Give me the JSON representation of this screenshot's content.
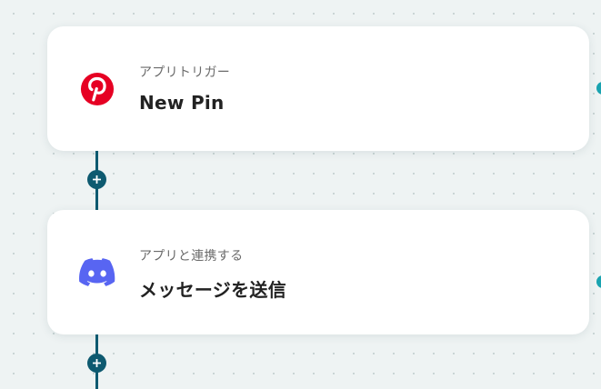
{
  "steps": [
    {
      "app": "Pinterest",
      "icon": "pinterest-icon",
      "brand_color": "#E60023",
      "subtitle": "アプリトリガー",
      "title": "New Pin"
    },
    {
      "app": "Discord",
      "icon": "discord-icon",
      "brand_color": "#5865F2",
      "subtitle": "アプリと連携する",
      "title": "メッセージを送信"
    }
  ],
  "add_step_icon": "plus-icon",
  "colors": {
    "connector": "#0E5A70",
    "handle": "#19A3B0",
    "background": "#EEF3F3",
    "card": "#FFFFFF"
  }
}
